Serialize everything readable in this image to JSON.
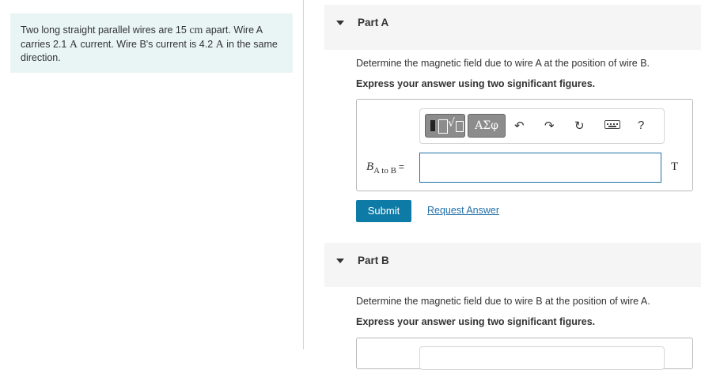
{
  "problem": {
    "text_1": "Two long straight parallel wires are 15 ",
    "unit_cm": "cm",
    "text_2": " apart. Wire A carries 2.1 ",
    "unit_a1": "A",
    "text_3": " current. Wire B's current is 4.2 ",
    "unit_a2": "A",
    "text_4": " in the same direction."
  },
  "part_a": {
    "title": "Part A",
    "question": "Determine the magnetic field due to wire A at the position of wire B.",
    "instruction": "Express your answer using two significant figures.",
    "toolbar": {
      "greek_label": "ΑΣφ",
      "help_label": "?"
    },
    "label_main": "B",
    "label_sub": "A to B",
    "label_eq": "=",
    "input_value": "",
    "unit": "T",
    "submit_label": "Submit",
    "request_label": "Request Answer"
  },
  "part_b": {
    "title": "Part B",
    "question": "Determine the magnetic field due to wire B at the position of wire A.",
    "instruction": "Express your answer using two significant figures."
  },
  "colors": {
    "problem_bg": "#e9f5f5",
    "submit_bg": "#0e7ba6",
    "link": "#1f6fa8",
    "toolbar_btn": "#8c8c8c"
  }
}
